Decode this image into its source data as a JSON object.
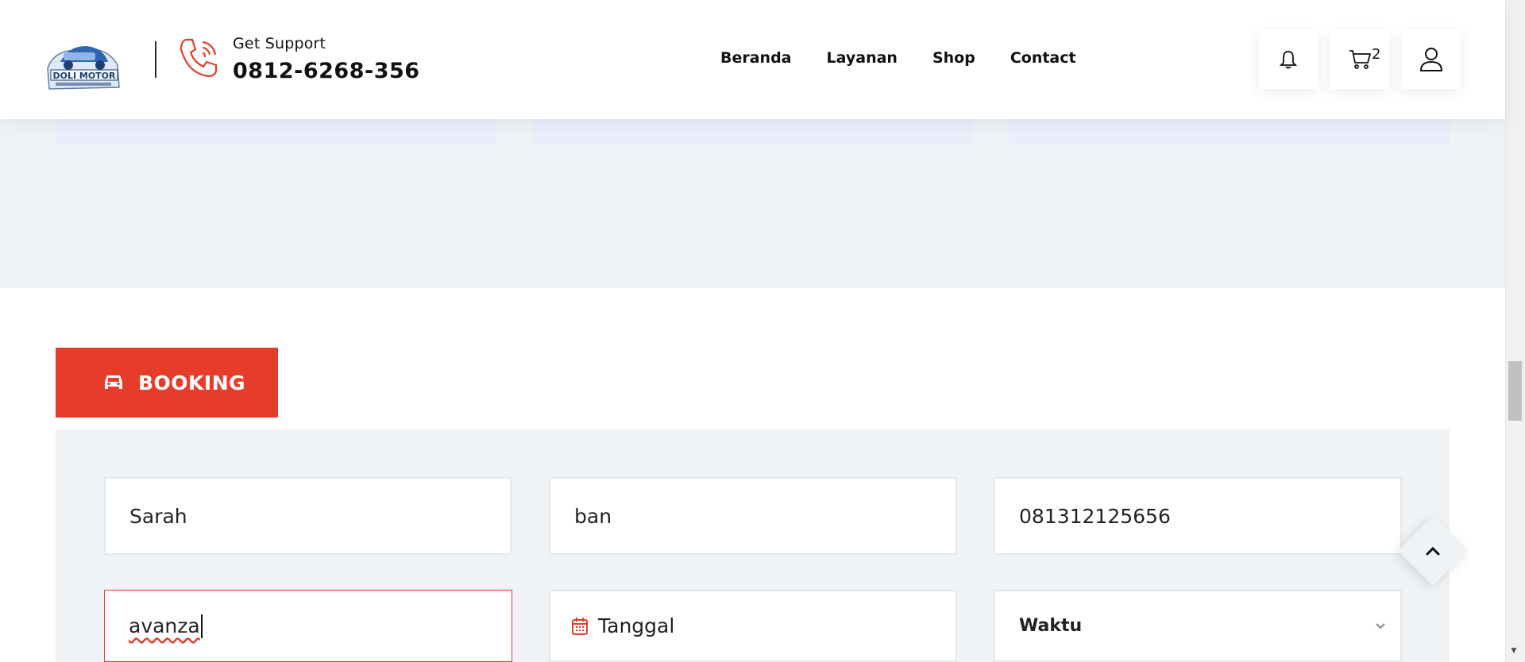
{
  "header": {
    "support_label": "Get Support",
    "support_phone": "0812-6268-356",
    "nav": [
      "Beranda",
      "Layanan",
      "Shop",
      "Contact"
    ],
    "cart_count": "2",
    "logo_text": "DOLI MOTOR"
  },
  "booking": {
    "tab_label": "BOOKING",
    "fields": {
      "name": "Sarah",
      "service": "ban",
      "phone": "081312125656",
      "car": "avanza",
      "date_placeholder": "Tanggal",
      "time_select": "Waktu"
    }
  },
  "icons": [
    "logo",
    "phone-icon",
    "bell-icon",
    "cart-icon",
    "user-icon",
    "car-icon",
    "calendar-icon",
    "chevron-down-icon",
    "chevron-up-icon"
  ],
  "colors": {
    "accent": "#e63c2b",
    "panel": "#eff3f5",
    "text": "#111111"
  }
}
